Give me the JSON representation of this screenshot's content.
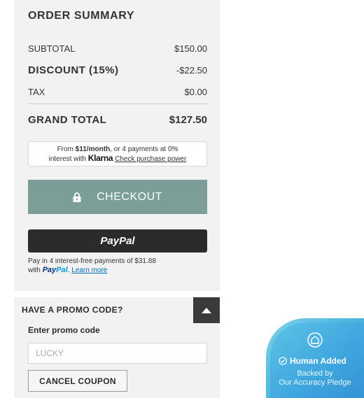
{
  "summary": {
    "title": "ORDER SUMMARY",
    "subtotal": {
      "label": "SUBTOTAL",
      "value": "$150.00"
    },
    "discount": {
      "label": "DISCOUNT (15%)",
      "value": "-$22.50"
    },
    "tax": {
      "label": "TAX",
      "value": "$0.00"
    },
    "grand_total": {
      "label": "GRAND TOTAL",
      "value": "$127.50"
    }
  },
  "klarna": {
    "prefix": "From ",
    "amount": "$11/month",
    "middle": ", or 4 payments at 0%",
    "line2_prefix": "interest with ",
    "logo": "Klarna",
    "link": "Check purchase power"
  },
  "checkout": {
    "label": "CHECKOUT",
    "icon": "lock-icon",
    "color": "#7c9e98"
  },
  "paypal": {
    "button_label": "PayPal",
    "note_line1": "Pay in 4 interest-free payments of $31.88",
    "note_with": "with ",
    "logo_pay": "Pay",
    "logo_pal": "Pal",
    "dot": ". ",
    "learn_more": "Learn more"
  },
  "promo": {
    "title": "HAVE A PROMO CODE?",
    "toggle_icon": "chevron-up-icon",
    "input_label": "Enter promo code",
    "input_placeholder": "LUCKY",
    "cancel_label": "CANCEL COUPON"
  },
  "badge": {
    "icon": "home-icon",
    "title": "Human Added",
    "line1": "Backed by",
    "line2": "Our Accuracy Pledge"
  }
}
